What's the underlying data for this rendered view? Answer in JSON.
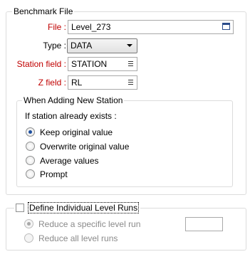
{
  "benchmark": {
    "title": "Benchmark File",
    "file_label": "File :",
    "file_value": "Level_273",
    "type_label": "Type :",
    "type_value": "DATA",
    "station_label": "Station field :",
    "station_value": "STATION",
    "z_label": "Z field :",
    "z_value": "RL"
  },
  "new_station": {
    "title": "When Adding New Station",
    "prompt": "If station already exists :",
    "options": [
      {
        "label": "Keep original value",
        "selected": true
      },
      {
        "label": "Overwrite original value",
        "selected": false
      },
      {
        "label": "Average values",
        "selected": false
      },
      {
        "label": "Prompt",
        "selected": false
      }
    ]
  },
  "level_runs": {
    "checkbox_label": "Define Individual Level Runs",
    "checked": false,
    "options": [
      {
        "label": "Reduce a specific level run",
        "selected": true
      },
      {
        "label": "Reduce all level runs",
        "selected": false
      }
    ],
    "run_value": ""
  }
}
